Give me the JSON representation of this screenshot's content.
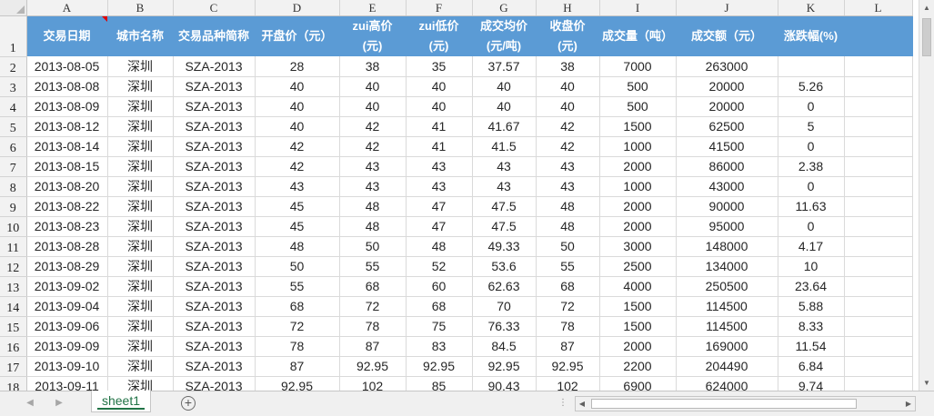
{
  "columns": [
    "A",
    "B",
    "C",
    "D",
    "E",
    "F",
    "G",
    "H",
    "I",
    "J",
    "K",
    "L"
  ],
  "header_row": {
    "row_number": "1",
    "cells": [
      {
        "line1": "交易日期",
        "line2": ""
      },
      {
        "line1": "城市名称",
        "line2": ""
      },
      {
        "line1": "交易品种简称",
        "line2": ""
      },
      {
        "line1": "开盘价（元）",
        "line2": ""
      },
      {
        "line1": "zui高价",
        "line2": "(元)"
      },
      {
        "line1": "zui低价",
        "line2": "(元)"
      },
      {
        "line1": "成交均价",
        "line2": "(元/吨)"
      },
      {
        "line1": "收盘价",
        "line2": "(元)"
      },
      {
        "line1": "成交量（吨）",
        "line2": ""
      },
      {
        "line1": "成交额（元）",
        "line2": ""
      },
      {
        "line1": "涨跌幅(%)",
        "line2": ""
      }
    ]
  },
  "rows": [
    {
      "row_number": "2",
      "cells": [
        "2013-08-05",
        "深圳",
        "SZA-2013",
        "28",
        "38",
        "35",
        "37.57",
        "38",
        "7000",
        "263000",
        ""
      ]
    },
    {
      "row_number": "3",
      "cells": [
        "2013-08-08",
        "深圳",
        "SZA-2013",
        "40",
        "40",
        "40",
        "40",
        "40",
        "500",
        "20000",
        "5.26"
      ]
    },
    {
      "row_number": "4",
      "cells": [
        "2013-08-09",
        "深圳",
        "SZA-2013",
        "40",
        "40",
        "40",
        "40",
        "40",
        "500",
        "20000",
        "0"
      ]
    },
    {
      "row_number": "5",
      "cells": [
        "2013-08-12",
        "深圳",
        "SZA-2013",
        "40",
        "42",
        "41",
        "41.67",
        "42",
        "1500",
        "62500",
        "5"
      ]
    },
    {
      "row_number": "6",
      "cells": [
        "2013-08-14",
        "深圳",
        "SZA-2013",
        "42",
        "42",
        "41",
        "41.5",
        "42",
        "1000",
        "41500",
        "0"
      ]
    },
    {
      "row_number": "7",
      "cells": [
        "2013-08-15",
        "深圳",
        "SZA-2013",
        "42",
        "43",
        "43",
        "43",
        "43",
        "2000",
        "86000",
        "2.38"
      ]
    },
    {
      "row_number": "8",
      "cells": [
        "2013-08-20",
        "深圳",
        "SZA-2013",
        "43",
        "43",
        "43",
        "43",
        "43",
        "1000",
        "43000",
        "0"
      ]
    },
    {
      "row_number": "9",
      "cells": [
        "2013-08-22",
        "深圳",
        "SZA-2013",
        "45",
        "48",
        "47",
        "47.5",
        "48",
        "2000",
        "90000",
        "11.63"
      ]
    },
    {
      "row_number": "10",
      "cells": [
        "2013-08-23",
        "深圳",
        "SZA-2013",
        "45",
        "48",
        "47",
        "47.5",
        "48",
        "2000",
        "95000",
        "0"
      ]
    },
    {
      "row_number": "11",
      "cells": [
        "2013-08-28",
        "深圳",
        "SZA-2013",
        "48",
        "50",
        "48",
        "49.33",
        "50",
        "3000",
        "148000",
        "4.17"
      ]
    },
    {
      "row_number": "12",
      "cells": [
        "2013-08-29",
        "深圳",
        "SZA-2013",
        "50",
        "55",
        "52",
        "53.6",
        "55",
        "2500",
        "134000",
        "10"
      ]
    },
    {
      "row_number": "13",
      "cells": [
        "2013-09-02",
        "深圳",
        "SZA-2013",
        "55",
        "68",
        "60",
        "62.63",
        "68",
        "4000",
        "250500",
        "23.64"
      ]
    },
    {
      "row_number": "14",
      "cells": [
        "2013-09-04",
        "深圳",
        "SZA-2013",
        "68",
        "72",
        "68",
        "70",
        "72",
        "1500",
        "114500",
        "5.88"
      ]
    },
    {
      "row_number": "15",
      "cells": [
        "2013-09-06",
        "深圳",
        "SZA-2013",
        "72",
        "78",
        "75",
        "76.33",
        "78",
        "1500",
        "114500",
        "8.33"
      ]
    },
    {
      "row_number": "16",
      "cells": [
        "2013-09-09",
        "深圳",
        "SZA-2013",
        "78",
        "87",
        "83",
        "84.5",
        "87",
        "2000",
        "169000",
        "11.54"
      ]
    },
    {
      "row_number": "17",
      "cells": [
        "2013-09-10",
        "深圳",
        "SZA-2013",
        "87",
        "92.95",
        "92.95",
        "92.95",
        "92.95",
        "2200",
        "204490",
        "6.84"
      ]
    },
    {
      "row_number": "18",
      "cells": [
        "2013-09-11",
        "深圳",
        "SZA-2013",
        "92.95",
        "102",
        "85",
        "90.43",
        "102",
        "6900",
        "624000",
        "9.74"
      ]
    }
  ],
  "sheet_tab": {
    "label": "sheet1"
  },
  "add_sheet": {
    "glyph": "+"
  },
  "nav": {
    "prev": "◀",
    "next": "▶"
  },
  "scroll": {
    "up": "▲",
    "down": "▼",
    "left": "◀",
    "right": "▶",
    "split": "⋮"
  },
  "colors": {
    "header_fill": "#5b9bd5",
    "header_text": "#ffffff",
    "tab_accent": "#217346",
    "comment_marker": "#e00000"
  }
}
